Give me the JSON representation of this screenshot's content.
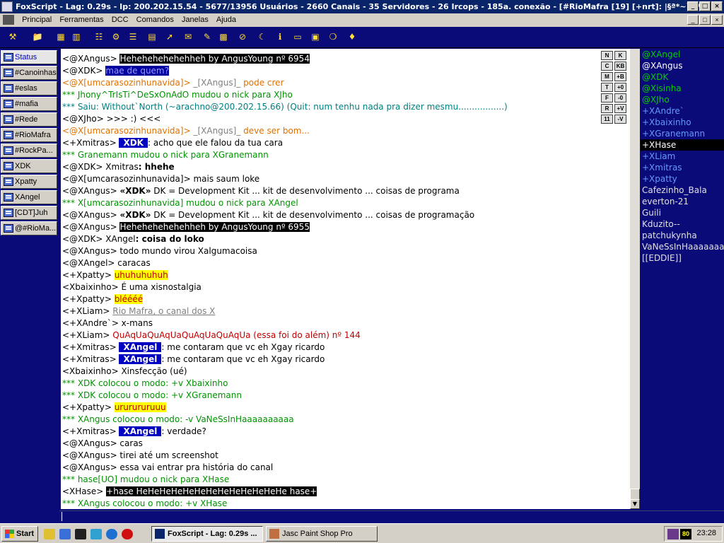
{
  "window": {
    "title": "FoxScript - Lag: 0.29s - Ip: 200.202.15.54 - 5677/13956 Usuários - 2660 Canais - 35 Servidores - 26 Ircops - 185a. conexão - [#RioMafra [19] [+nrt]: |§ª*~`~*ª]",
    "buttons": {
      "min": "_",
      "max": "□",
      "close": "×"
    }
  },
  "menu": [
    "Principal",
    "Ferramentas",
    "DCC",
    "Comandos",
    "Janelas",
    "Ajuda"
  ],
  "mdi_buttons": {
    "min": "_",
    "max": "□",
    "close": "×"
  },
  "toolbar_icons": [
    "tools-icon",
    "folder-icon",
    "channel-list-icon",
    "address-book-icon",
    "notify-icon",
    "options-icon",
    "list-icon",
    "log-icon",
    "dcc-send-icon",
    "dcc-chat-icon",
    "script-icon",
    "colors-icon",
    "ignore-icon",
    "away-icon",
    "about-icon",
    "cascade-icon",
    "tile-icon",
    "help-icon",
    "light-icon"
  ],
  "switchbar": [
    "Status",
    "#Canoinhas",
    "#eslas",
    "#mafia",
    "#Rede",
    "#RioMafra",
    "#RockPa...",
    "XDK",
    "Xpatty",
    "XAngel",
    "[CDT]Juh",
    "@#RioMa..."
  ],
  "format_buttons": [
    [
      "N",
      "K"
    ],
    [
      "C",
      "KB"
    ],
    [
      "M",
      "+B"
    ],
    [
      "T",
      "+0"
    ],
    [
      "F",
      "-0"
    ],
    [
      "R",
      "+V"
    ],
    [
      "11",
      "-V"
    ]
  ],
  "chat_lines": [
    [
      {
        "t": "<@XAngus> ",
        "c": "k"
      },
      {
        "t": "Hehehehehehehheh by AngusYoung nº 6954",
        "c": "inv"
      }
    ],
    [
      {
        "t": "<@XDK> ",
        "c": "k"
      },
      {
        "t": "mae de quem?",
        "c": "sel"
      }
    ],
    [
      {
        "t": "<@X[umcarasozinhunavida]> ",
        "c": "o"
      },
      {
        "t": "_[XAngus]_",
        "c": "gr"
      },
      {
        "t": " pode crer",
        "c": "o"
      }
    ],
    [
      {
        "t": "*** Jhony^TrIsTi^DeSxOnAdO mudou o nick para XJho",
        "c": "g"
      }
    ],
    [
      {
        "t": "*** Saiu: Without`North (~arachno@200.202.15.66) (Quit: num tenhu nada pra dizer mesmu.................)",
        "c": "t"
      }
    ],
    [
      {
        "t": "<@XJho> >>> ",
        "c": "k"
      },
      {
        "t": ":)",
        "c": "k"
      },
      {
        "t": " <<<",
        "c": "k"
      }
    ],
    [
      {
        "t": "<@X[umcarasozinhunavida]> ",
        "c": "o"
      },
      {
        "t": "_[XAngus]_",
        "c": "gr"
      },
      {
        "t": " deve ser bom...",
        "c": "o"
      }
    ],
    [
      {
        "t": "<+Xmitras> ",
        "c": "k"
      },
      {
        "t": "XDK",
        "c": "bl"
      },
      {
        "t": ": acho que ele falou da tua cara",
        "c": "k"
      }
    ],
    [
      {
        "t": "*** Granemann mudou o nick para XGranemann",
        "c": "g"
      }
    ],
    [
      {
        "t": "<@XDK> ",
        "c": "k"
      },
      {
        "t": "Xmitras",
        "c": "k"
      },
      {
        "t": ": hhehe",
        "c": "b"
      }
    ],
    [
      {
        "t": "<@X[umcarasozinhunavida]> mais saum loke",
        "c": "k"
      }
    ],
    [
      {
        "t": "<@XAngus> ",
        "c": "k"
      },
      {
        "t": "«XDK»",
        "c": "b"
      },
      {
        "t": " DK = Development Kit ... kit de desenvolvimento ... coisas de programa",
        "c": "k"
      }
    ],
    [
      {
        "t": "*** X[umcarasozinhunavida] mudou o nick para XAngel",
        "c": "g"
      }
    ],
    [
      {
        "t": "<@XAngus> ",
        "c": "k"
      },
      {
        "t": "«XDK»",
        "c": "b"
      },
      {
        "t": " DK = Development Kit ... kit de desenvolvimento ... coisas de programação",
        "c": "k"
      }
    ],
    [
      {
        "t": "<@XAngus> ",
        "c": "k"
      },
      {
        "t": "Hehehehehehehheh by AngusYoung nº 6955",
        "c": "inv"
      }
    ],
    [
      {
        "t": "<@XDK> ",
        "c": "k"
      },
      {
        "t": "XAngel",
        "c": "k"
      },
      {
        "t": ": coisa do loko",
        "c": "b"
      }
    ],
    [
      {
        "t": "<@XAngus> todo mundo virou Xalgumacoisa",
        "c": "k"
      }
    ],
    [
      {
        "t": "<@XAngel> caracas",
        "c": "k"
      }
    ],
    [
      {
        "t": "<+Xpatty> ",
        "c": "k"
      },
      {
        "t": "uhuhuhuhuh",
        "c": "yl"
      }
    ],
    [
      {
        "t": "<Xbaixinho> É uma xisnostalgia",
        "c": "k"
      }
    ],
    [
      {
        "t": "<+Xpatty> ",
        "c": "k"
      },
      {
        "t": "bléééé",
        "c": "yl"
      }
    ],
    [
      {
        "t": "<+XLiam> ",
        "c": "k"
      },
      {
        "t": "Rio Mafra, o canal dos X",
        "c": "gr u"
      }
    ],
    [
      {
        "t": "<+XAndre`> x-mans",
        "c": "k"
      }
    ],
    [
      {
        "t": "<+XLiam> ",
        "c": "k"
      },
      {
        "t": "QuAqUaQuAqUaQuAqUaQuAqUa (essa foi do além) nº 144",
        "c": "r"
      }
    ],
    [
      {
        "t": "<+Xmitras> ",
        "c": "k"
      },
      {
        "t": "XAngel",
        "c": "bl"
      },
      {
        "t": ": me contaram que vc eh Xgay ricardo",
        "c": "k"
      }
    ],
    [
      {
        "t": "<+Xmitras> ",
        "c": "k"
      },
      {
        "t": "XAngel",
        "c": "bl"
      },
      {
        "t": ": me contaram que vc eh Xgay ricardo",
        "c": "k"
      }
    ],
    [
      {
        "t": "<Xbaixinho> Xinsfecção (ué)",
        "c": "k"
      }
    ],
    [
      {
        "t": "*** XDK colocou o modo: +v Xbaixinho",
        "c": "g"
      }
    ],
    [
      {
        "t": "*** XDK colocou o modo: +v XGranemann",
        "c": "g"
      }
    ],
    [
      {
        "t": "<+Xpatty> ",
        "c": "k"
      },
      {
        "t": "ururururuuu",
        "c": "yl"
      }
    ],
    [
      {
        "t": "*** XAngus colocou o modo: -v VaNeSsInHaaaaaaaaaa",
        "c": "g"
      }
    ],
    [
      {
        "t": "<+Xmitras> ",
        "c": "k"
      },
      {
        "t": "XAngel",
        "c": "bl"
      },
      {
        "t": ": verdade?",
        "c": "k"
      }
    ],
    [
      {
        "t": "<@XAngus> caras",
        "c": "k"
      }
    ],
    [
      {
        "t": "<@XAngus> tirei até um screenshot",
        "c": "k"
      }
    ],
    [
      {
        "t": "<@XAngus> essa vai entrar pra história do canal",
        "c": "k"
      }
    ],
    [
      {
        "t": "*** hase[UO] mudou o nick para XHase",
        "c": "g"
      }
    ],
    [
      {
        "t": "<XHase> ",
        "c": "k"
      },
      {
        "t": "+hase HeHeHeHeHeHeHeHeHeHeHeHeHe hase+",
        "c": "inv"
      }
    ],
    [
      {
        "t": "*** XAngus colocou o modo: +v XHase",
        "c": "g"
      }
    ]
  ],
  "nicklist": [
    {
      "n": "@XAngel",
      "c": "op"
    },
    {
      "n": "@XAngus",
      "c": "opw"
    },
    {
      "n": "@XDK",
      "c": "op"
    },
    {
      "n": "@Xisinha",
      "c": "op"
    },
    {
      "n": "@XJho",
      "c": "op"
    },
    {
      "n": "+XAndre`",
      "c": "voice"
    },
    {
      "n": "+Xbaixinho",
      "c": "voice"
    },
    {
      "n": "+XGranemann",
      "c": "voice"
    },
    {
      "n": "+XHase",
      "c": "hl"
    },
    {
      "n": "+XLiam",
      "c": "voice"
    },
    {
      "n": "+Xmitras",
      "c": "voice"
    },
    {
      "n": "+Xpatty",
      "c": "voice"
    },
    {
      "n": "Cafezinho_Bala",
      "c": "norm"
    },
    {
      "n": "everton-21",
      "c": "norm"
    },
    {
      "n": "Guili",
      "c": "norm"
    },
    {
      "n": "Kduzito--",
      "c": "norm"
    },
    {
      "n": "patchukynha",
      "c": "norm"
    },
    {
      "n": "VaNeSsInHaaaaaaaaaa",
      "c": "norm"
    },
    {
      "n": "[[EDDIE]]",
      "c": "norm"
    }
  ],
  "input": {
    "value": ""
  },
  "taskbar": {
    "start": "Start",
    "tasks": [
      {
        "label": "FoxScript - Lag: 0.29s ...",
        "active": true
      },
      {
        "label": "Jasc Paint Shop Pro",
        "active": false
      }
    ],
    "tray_indicator": "80",
    "clock": "23:28"
  }
}
